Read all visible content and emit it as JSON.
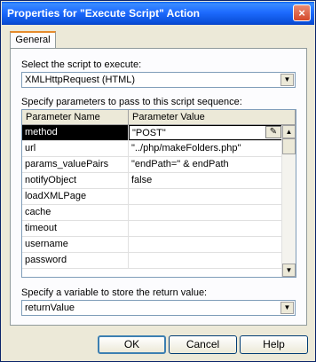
{
  "window": {
    "title": "Properties for \"Execute Script\" Action",
    "close_glyph": "×"
  },
  "tabs": [
    {
      "label": "General"
    }
  ],
  "script": {
    "label": "Select the script to execute:",
    "value": "XMLHttpRequest (HTML)"
  },
  "params": {
    "label": "Specify parameters to pass to this script sequence:",
    "columns": [
      "Parameter Name",
      "Parameter Value"
    ],
    "rows": [
      {
        "name": "method",
        "value": "\"POST\""
      },
      {
        "name": "url",
        "value": "\"../php/makeFolders.php\""
      },
      {
        "name": "params_valuePairs",
        "value": "\"endPath=\" & endPath"
      },
      {
        "name": "notifyObject",
        "value": "false"
      },
      {
        "name": "loadXMLPage",
        "value": ""
      },
      {
        "name": "cache",
        "value": ""
      },
      {
        "name": "timeout",
        "value": ""
      },
      {
        "name": "username",
        "value": ""
      },
      {
        "name": "password",
        "value": ""
      }
    ]
  },
  "return_var": {
    "label": "Specify a variable to store the return value:",
    "value": "returnValue"
  },
  "buttons": {
    "ok": "OK",
    "cancel": "Cancel",
    "help": "Help"
  }
}
